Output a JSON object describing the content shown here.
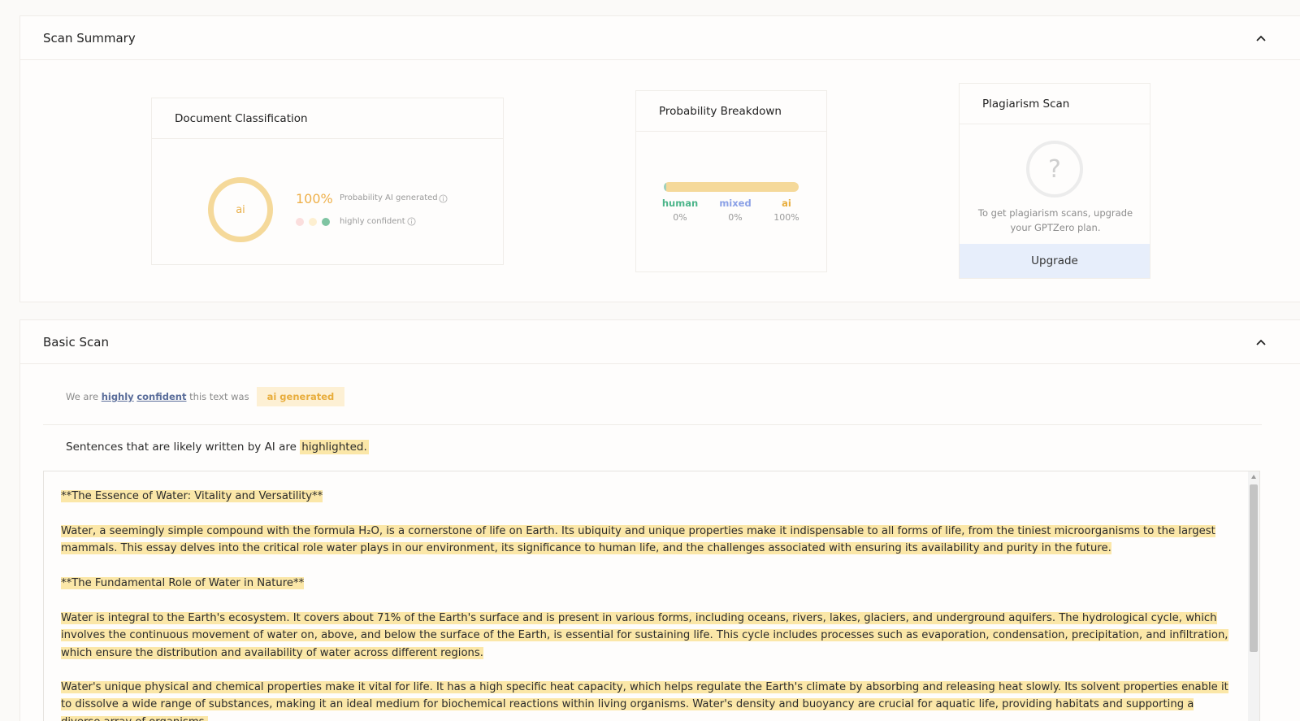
{
  "scan_summary": {
    "title": "Scan Summary",
    "classification": {
      "title": "Document Classification",
      "ring_label": "ai",
      "percent": "100%",
      "probability_label": "Probability AI generated",
      "confidence_label": "highly confident",
      "dot_colors": [
        "#fbdedd",
        "#fdefd0",
        "#7fc4a2"
      ]
    },
    "breakdown": {
      "title": "Probability Breakdown",
      "fractions": {
        "human": 0.0,
        "mixed": 0.0,
        "ai": 1.0
      },
      "human_label": "human",
      "human_value": "0%",
      "mixed_label": "mixed",
      "mixed_value": "0%",
      "ai_label": "ai",
      "ai_value": "100%",
      "colors": {
        "human": "#4cb58a",
        "mixed": "#8aa0e6",
        "ai": "#e8ad3c"
      }
    },
    "plagiarism": {
      "title": "Plagiarism Scan",
      "icon_glyph": "?",
      "message": "To get plagiarism scans, upgrade your GPTZero plan.",
      "upgrade_label": "Upgrade"
    }
  },
  "basic_scan": {
    "title": "Basic Scan",
    "confidence": {
      "prefix": "We are",
      "word1": "highly",
      "word2": "confident",
      "suffix": "this text was",
      "badge": "ai generated"
    },
    "highlight_note": {
      "prefix": "Sentences that are likely written by AI are",
      "highlighted": "highlighted."
    },
    "paragraphs": [
      "**The Essence of Water: Vitality and Versatility**",
      "Water, a seemingly simple compound with the formula H₂O, is a cornerstone of life on Earth. Its ubiquity and unique properties make it indispensable to all forms of life, from the tiniest microorganisms to the largest mammals. This essay delves into the critical role water plays in our environment, its significance to human life, and the challenges associated with ensuring its availability and purity in the future.",
      "**The Fundamental Role of Water in Nature**",
      "Water is integral to the Earth's ecosystem. It covers about 71% of the Earth's surface and is present in various forms, including oceans, rivers, lakes, glaciers, and underground aquifers. The hydrological cycle, which involves the continuous movement of water on, above, and below the surface of the Earth, is essential for sustaining life. This cycle includes processes such as evaporation, condensation, precipitation, and infiltration, which ensure the distribution and availability of water across different regions.",
      "Water's unique physical and chemical properties make it vital for life. It has a high specific heat capacity, which helps regulate the Earth's climate by absorbing and releasing heat slowly. Its solvent properties enable it to dissolve a wide range of substances, making it an ideal medium for biochemical reactions within living organisms. Water's density and buoyancy are crucial for aquatic life, providing habitats and supporting a diverse array of organisms."
    ]
  }
}
